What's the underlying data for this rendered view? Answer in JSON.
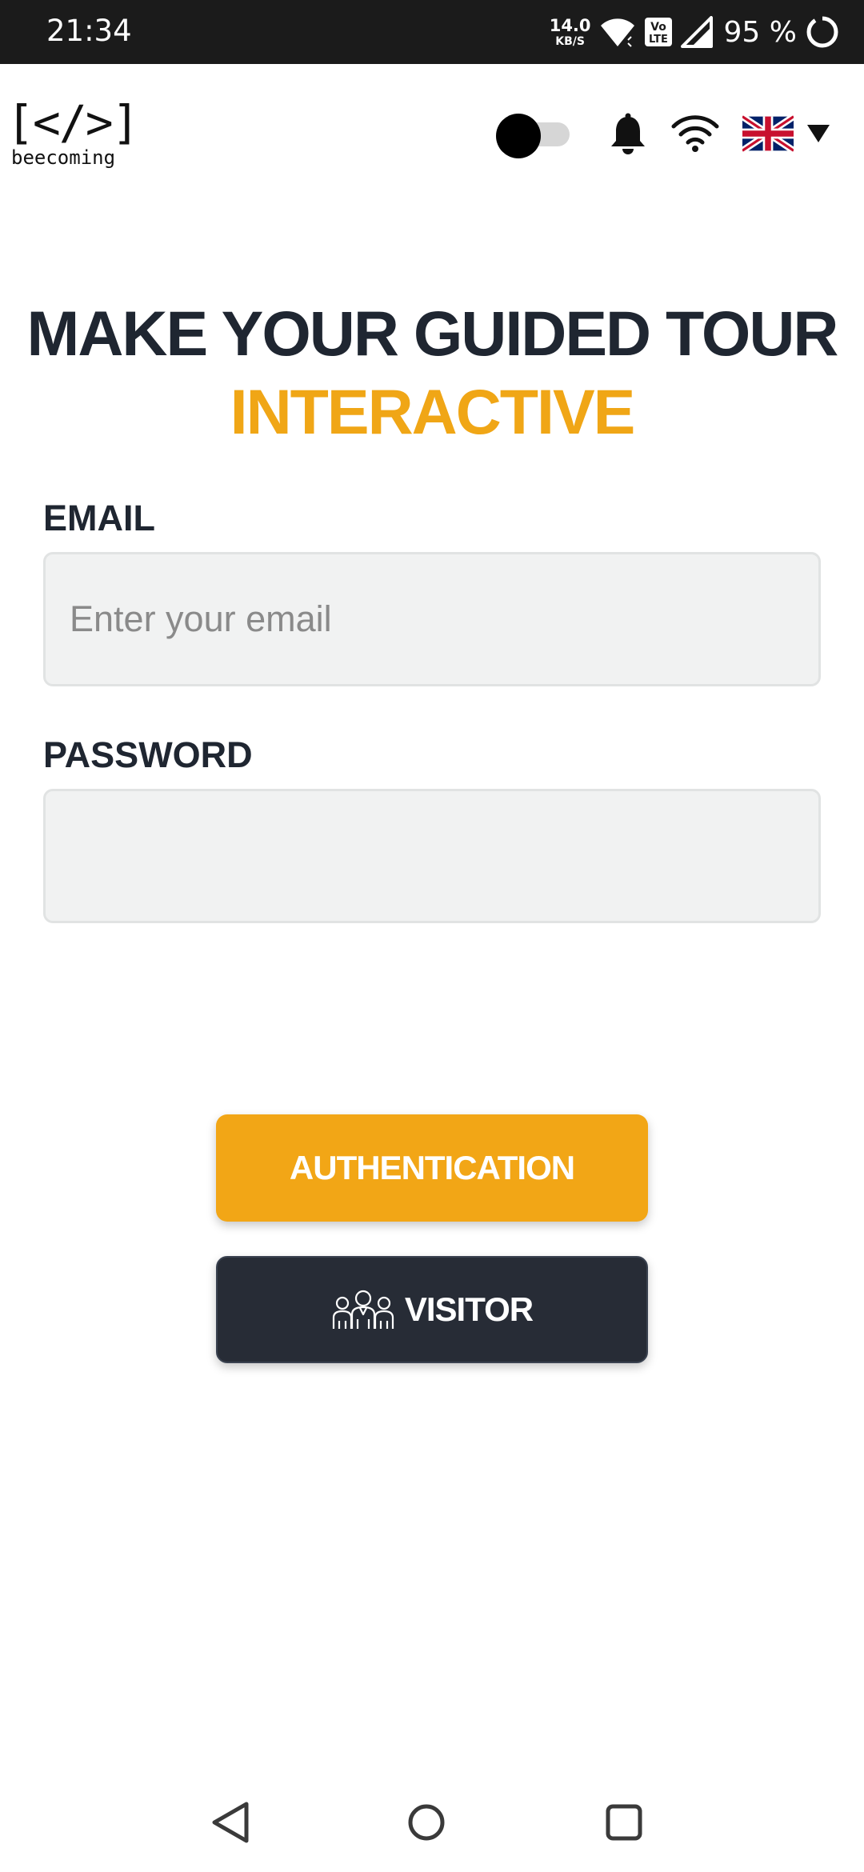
{
  "status_bar": {
    "time": "21:34",
    "net_speed_value": "14.0",
    "net_speed_unit": "KB/S",
    "volte_label_top": "Vo",
    "volte_label_bottom": "LTE",
    "battery": "95 %",
    "icons": [
      "wifi-icon",
      "volte-icon",
      "signal-icon",
      "battery-ring-icon"
    ]
  },
  "header": {
    "logo_mark": "[</>]",
    "logo_text": "beecoming",
    "theme_toggle_on": false,
    "icons": [
      "bell-icon",
      "wifi-icon",
      "uk-flag-icon",
      "caret-down-icon"
    ]
  },
  "hero": {
    "line1": "MAKE YOUR GUIDED TOUR",
    "line2": "INTERACTIVE",
    "accent_color": "#f0a616"
  },
  "form": {
    "email_label": "EMAIL",
    "email_placeholder": "Enter your email",
    "email_value": "",
    "password_label": "PASSWORD",
    "password_value": ""
  },
  "buttons": {
    "auth_label": "AUTHENTICATION",
    "visitor_label": "VISITOR",
    "auth_color": "#f2a616",
    "visitor_color": "#272c36"
  },
  "nav_bar": {
    "icons": [
      "back-icon",
      "home-icon",
      "recents-icon"
    ]
  }
}
